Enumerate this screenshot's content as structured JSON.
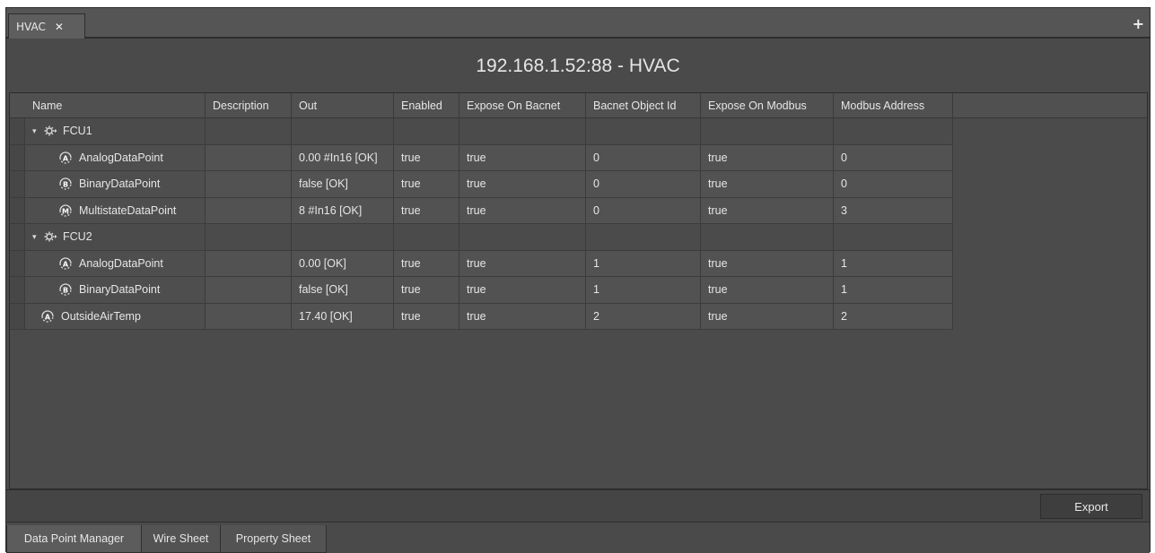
{
  "tabbar": {
    "tab_label": "HVAC",
    "close_glyph": "✕",
    "add_glyph": "+"
  },
  "title": "192.168.1.52:88 - HVAC",
  "columns": [
    "Name",
    "Description",
    "Out",
    "Enabled",
    "Expose On Bacnet",
    "Bacnet Object Id",
    "Expose On Modbus",
    "Modbus Address"
  ],
  "rows": [
    {
      "type": "folder",
      "name": "FCU1",
      "icon": "gear-folder-icon"
    },
    {
      "type": "point",
      "icon_letter": "A",
      "name": "AnalogDataPoint",
      "description": "",
      "out": "0.00 #In16 [OK]",
      "enabled": "true",
      "expose_bacnet": "true",
      "bacnet_id": "0",
      "expose_modbus": "true",
      "modbus_address": "0"
    },
    {
      "type": "point",
      "icon_letter": "B",
      "name": "BinaryDataPoint",
      "description": "",
      "out": "false [OK]",
      "enabled": "true",
      "expose_bacnet": "true",
      "bacnet_id": "0",
      "expose_modbus": "true",
      "modbus_address": "0"
    },
    {
      "type": "point",
      "icon_letter": "M",
      "name": "MultistateDataPoint",
      "description": "",
      "out": "8 #In16 [OK]",
      "enabled": "true",
      "expose_bacnet": "true",
      "bacnet_id": "0",
      "expose_modbus": "true",
      "modbus_address": "3"
    },
    {
      "type": "folder",
      "name": "FCU2",
      "icon": "gear-folder-icon"
    },
    {
      "type": "point",
      "icon_letter": "A",
      "name": "AnalogDataPoint",
      "description": "",
      "out": "0.00 [OK]",
      "enabled": "true",
      "expose_bacnet": "true",
      "bacnet_id": "1",
      "expose_modbus": "true",
      "modbus_address": "1"
    },
    {
      "type": "point",
      "icon_letter": "B",
      "name": "BinaryDataPoint",
      "description": "",
      "out": "false [OK]",
      "enabled": "true",
      "expose_bacnet": "true",
      "bacnet_id": "1",
      "expose_modbus": "true",
      "modbus_address": "1"
    },
    {
      "type": "point",
      "icon_letter": "A",
      "name": "OutsideAirTemp",
      "description": "",
      "out": "17.40 [OK]",
      "enabled": "true",
      "expose_bacnet": "true",
      "bacnet_id": "2",
      "expose_modbus": "true",
      "modbus_address": "2"
    }
  ],
  "export_label": "Export",
  "view_tabs": [
    "Data Point Manager",
    "Wire Sheet",
    "Property Sheet"
  ],
  "colors": {
    "background": "#4a4a4a",
    "row_bg": "#525252",
    "text": "#e6e6e6"
  }
}
